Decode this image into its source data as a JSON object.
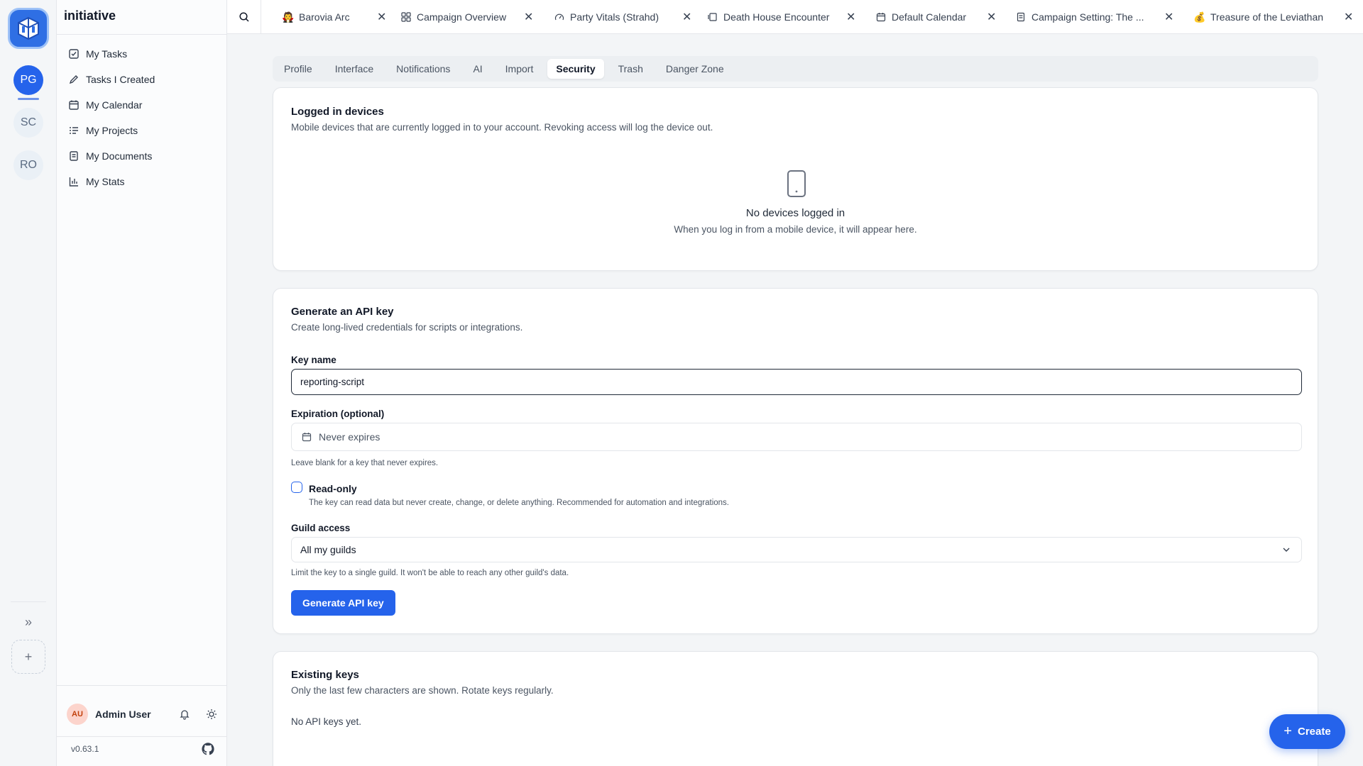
{
  "app": {
    "workspace": "initiative",
    "version": "v0.63.1"
  },
  "rail": {
    "guilds": [
      {
        "initials": "PG",
        "active": true
      },
      {
        "initials": "SC",
        "active": false
      },
      {
        "initials": "RO",
        "active": false
      }
    ],
    "expand_icon": "chevrons-right-icon",
    "add_icon": "plus-icon"
  },
  "sidebar": {
    "items": [
      {
        "label": "My Tasks",
        "icon": "check-square-icon"
      },
      {
        "label": "Tasks I Created",
        "icon": "pencil-icon"
      },
      {
        "label": "My Calendar",
        "icon": "calendar-icon"
      },
      {
        "label": "My Projects",
        "icon": "list-icon"
      },
      {
        "label": "My Documents",
        "icon": "document-icon"
      },
      {
        "label": "My Stats",
        "icon": "bar-chart-icon"
      }
    ],
    "user": {
      "initials": "AU",
      "name": "Admin User"
    }
  },
  "tabs": [
    {
      "label": "Barovia Arc",
      "icon": "vampire-emoji"
    },
    {
      "label": "Campaign Overview",
      "icon": "grid-icon"
    },
    {
      "label": "Party Vitals (Strahd)",
      "icon": "gauge-icon"
    },
    {
      "label": "Death House Encounter",
      "icon": "panels-icon"
    },
    {
      "label": "Default Calendar",
      "icon": "calendar-icon"
    },
    {
      "label": "Campaign Setting: The ...",
      "icon": "document-icon"
    },
    {
      "label": "Treasure of the Leviathan",
      "icon": "money-bag-emoji"
    }
  ],
  "settings_tabs": [
    "Profile",
    "Interface",
    "Notifications",
    "AI",
    "Import",
    "Security",
    "Trash",
    "Danger Zone"
  ],
  "active_settings_tab": "Security",
  "devices": {
    "title": "Logged in devices",
    "description": "Mobile devices that are currently logged in to your account. Revoking access will log the device out.",
    "empty_title": "No devices logged in",
    "empty_sub": "When you log in from a mobile device, it will appear here."
  },
  "api_key": {
    "title": "Generate an API key",
    "description": "Create long-lived credentials for scripts or integrations.",
    "key_name_label": "Key name",
    "key_name_value": "reporting-script",
    "expiration_label": "Expiration (optional)",
    "expiration_placeholder": "Never expires",
    "expiration_hint": "Leave blank for a key that never expires.",
    "readonly_label": "Read-only",
    "readonly_checked": false,
    "readonly_hint": "The key can read data but never create, change, or delete anything. Recommended for automation and integrations.",
    "guild_label": "Guild access",
    "guild_value": "All my guilds",
    "guild_hint": "Limit the key to a single guild. It won't be able to reach any other guild's data.",
    "generate_label": "Generate API key"
  },
  "existing": {
    "title": "Existing keys",
    "description": "Only the last few characters are shown. Rotate keys regularly.",
    "empty": "No API keys yet."
  },
  "fab": {
    "label": "Create"
  },
  "colors": {
    "accent": "#2563eb"
  }
}
